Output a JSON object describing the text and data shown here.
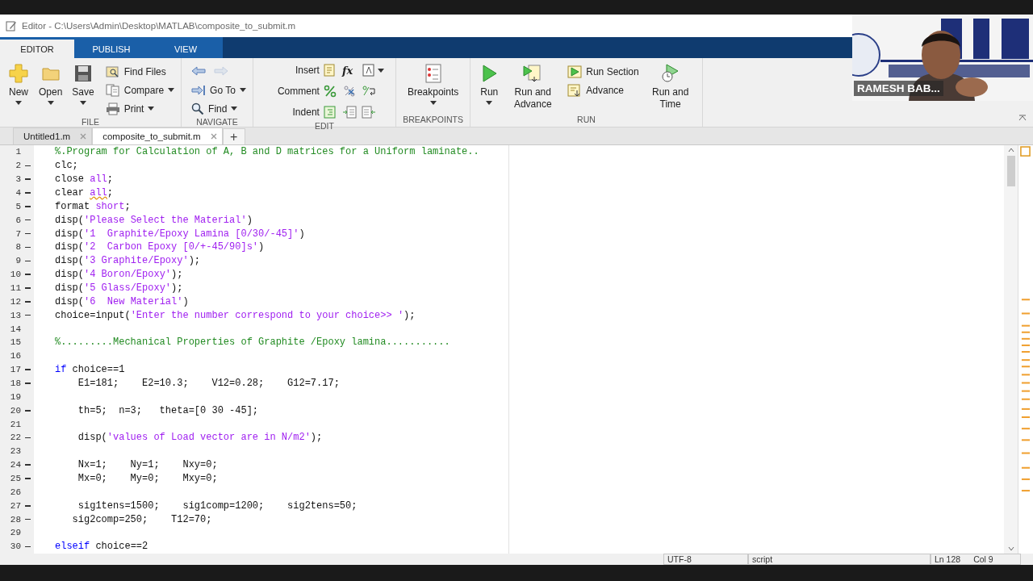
{
  "window": {
    "title": "Editor - C:\\Users\\Admin\\Desktop\\MATLAB\\composite_to_submit.m"
  },
  "ribbon_tabs": [
    {
      "label": "EDITOR",
      "selected": true
    },
    {
      "label": "PUBLISH",
      "selected": false
    },
    {
      "label": "VIEW",
      "selected": false
    }
  ],
  "ribbon": {
    "file": {
      "label": "FILE",
      "new": {
        "label": "New",
        "dropdown": true
      },
      "open": {
        "label": "Open",
        "dropdown": true
      },
      "save": {
        "label": "Save",
        "dropdown": true
      },
      "find_files": {
        "label": "Find Files"
      },
      "compare": {
        "label": "Compare",
        "dropdown": true
      },
      "print": {
        "label": "Print",
        "dropdown": true
      }
    },
    "navigate": {
      "label": "NAVIGATE",
      "back": {
        "disabled": false
      },
      "forward": {
        "disabled": true
      },
      "go_to": {
        "label": "Go To",
        "dropdown": true
      },
      "find": {
        "label": "Find",
        "dropdown": true
      }
    },
    "edit": {
      "label": "EDIT",
      "insert": {
        "label": "Insert"
      },
      "function_glyph": "fx",
      "comment": {
        "label": "Comment"
      },
      "indent": {
        "label": "Indent"
      }
    },
    "breakpoints": {
      "label": "BREAKPOINTS",
      "button": {
        "label": "Breakpoints",
        "dropdown": true
      }
    },
    "run": {
      "label": "RUN",
      "run": {
        "label": "Run",
        "dropdown": true
      },
      "run_and_advance": {
        "label": "Run and Advance"
      },
      "run_section": {
        "label": "Run Section"
      },
      "advance": {
        "label": "Advance"
      },
      "run_and_time": {
        "label": "Run and Time"
      }
    }
  },
  "document_tabs": [
    {
      "label": "Untitled1.m",
      "selected": false
    },
    {
      "label": "composite_to_submit.m",
      "selected": true
    }
  ],
  "new_tab_glyph": "+",
  "code_lines": [
    {
      "number": "1",
      "executable": false,
      "tokens": [
        {
          "kind": "comment",
          "text": "%.Program for Calculation of A, B and D matrices for a Uniform laminate.."
        }
      ]
    },
    {
      "number": "2",
      "executable": true,
      "tokens": [
        {
          "kind": "code",
          "text": "clc;"
        }
      ]
    },
    {
      "number": "3",
      "executable": true,
      "tokens": [
        {
          "kind": "code",
          "text": "close "
        },
        {
          "kind": "string",
          "text": "all"
        },
        {
          "kind": "code",
          "text": ";"
        }
      ]
    },
    {
      "number": "4",
      "executable": true,
      "tokens": [
        {
          "kind": "code",
          "text": "clear "
        },
        {
          "kind": "string",
          "text": "all",
          "warning": true
        },
        {
          "kind": "code",
          "text": ";"
        }
      ]
    },
    {
      "number": "5",
      "executable": true,
      "tokens": [
        {
          "kind": "code",
          "text": "format "
        },
        {
          "kind": "string",
          "text": "short"
        },
        {
          "kind": "code",
          "text": ";"
        }
      ]
    },
    {
      "number": "6",
      "executable": true,
      "tokens": [
        {
          "kind": "code",
          "text": "disp("
        },
        {
          "kind": "string",
          "text": "'Please Select the Material'"
        },
        {
          "kind": "code",
          "text": ")"
        }
      ]
    },
    {
      "number": "7",
      "executable": true,
      "tokens": [
        {
          "kind": "code",
          "text": "disp("
        },
        {
          "kind": "string",
          "text": "'1  Graphite/Epoxy Lamina [0/30/-45]'"
        },
        {
          "kind": "code",
          "text": ")"
        }
      ]
    },
    {
      "number": "8",
      "executable": true,
      "tokens": [
        {
          "kind": "code",
          "text": "disp("
        },
        {
          "kind": "string",
          "text": "'2  Carbon Epoxy [0/+-45/90]s'"
        },
        {
          "kind": "code",
          "text": ")"
        }
      ]
    },
    {
      "number": "9",
      "executable": true,
      "tokens": [
        {
          "kind": "code",
          "text": "disp("
        },
        {
          "kind": "string",
          "text": "'3 Graphite/Epoxy'"
        },
        {
          "kind": "code",
          "text": ");"
        }
      ]
    },
    {
      "number": "10",
      "executable": true,
      "tokens": [
        {
          "kind": "code",
          "text": "disp("
        },
        {
          "kind": "string",
          "text": "'4 Boron/Epoxy'"
        },
        {
          "kind": "code",
          "text": ");"
        }
      ]
    },
    {
      "number": "11",
      "executable": true,
      "tokens": [
        {
          "kind": "code",
          "text": "disp("
        },
        {
          "kind": "string",
          "text": "'5 Glass/Epoxy'"
        },
        {
          "kind": "code",
          "text": ");"
        }
      ]
    },
    {
      "number": "12",
      "executable": true,
      "tokens": [
        {
          "kind": "code",
          "text": "disp("
        },
        {
          "kind": "string",
          "text": "'6  New Material'"
        },
        {
          "kind": "code",
          "text": ")"
        }
      ]
    },
    {
      "number": "13",
      "executable": true,
      "tokens": [
        {
          "kind": "code",
          "text": "choice=input("
        },
        {
          "kind": "string",
          "text": "'Enter the number correspond to your choice>> '"
        },
        {
          "kind": "code",
          "text": ");"
        }
      ]
    },
    {
      "number": "14",
      "executable": false
    },
    {
      "number": "15",
      "executable": false,
      "tokens": [
        {
          "kind": "comment",
          "text": "%.........Mechanical Properties of Graphite /Epoxy lamina..........."
        }
      ]
    },
    {
      "number": "16",
      "executable": false
    },
    {
      "number": "17",
      "executable": true,
      "tokens": [
        {
          "kind": "keyword",
          "text": "if"
        },
        {
          "kind": "code",
          "text": " choice==1"
        }
      ]
    },
    {
      "number": "18",
      "executable": true,
      "tokens": [
        {
          "kind": "code",
          "text": "    E1=181;    E2=10.3;    V12=0.28;    G12=7.17;"
        }
      ]
    },
    {
      "number": "19",
      "executable": false
    },
    {
      "number": "20",
      "executable": true,
      "tokens": [
        {
          "kind": "code",
          "text": "    th=5;  n=3;   theta=[0 30 -45];"
        }
      ]
    },
    {
      "number": "21",
      "executable": false
    },
    {
      "number": "22",
      "executable": true,
      "tokens": [
        {
          "kind": "code",
          "text": "    disp("
        },
        {
          "kind": "string",
          "text": "'values of Load vector are in N/m2'"
        },
        {
          "kind": "code",
          "text": ");"
        }
      ]
    },
    {
      "number": "23",
      "executable": false
    },
    {
      "number": "24",
      "executable": true,
      "tokens": [
        {
          "kind": "code",
          "text": "    Nx=1;    Ny=1;    Nxy=0;"
        }
      ]
    },
    {
      "number": "25",
      "executable": true,
      "tokens": [
        {
          "kind": "code",
          "text": "    Mx=0;    My=0;    Mxy=0;"
        }
      ]
    },
    {
      "number": "26",
      "executable": false
    },
    {
      "number": "27",
      "executable": true,
      "tokens": [
        {
          "kind": "code",
          "text": "    sig1tens=1500;    sig1comp=1200;    sig2tens=50;"
        }
      ]
    },
    {
      "number": "28",
      "executable": true,
      "tokens": [
        {
          "kind": "code",
          "text": "   sig2comp=250;    T12=70;"
        }
      ]
    },
    {
      "number": "29",
      "executable": false
    },
    {
      "number": "30",
      "executable": true,
      "tokens": [
        {
          "kind": "keyword",
          "text": "elseif"
        },
        {
          "kind": "code",
          "text": " choice==2"
        }
      ]
    }
  ],
  "status_bar": {
    "encoding": "UTF-8",
    "file_type": "script",
    "line": "Ln  128",
    "column": "Col  9"
  },
  "video": {
    "name": "RAMESH BAB..."
  }
}
